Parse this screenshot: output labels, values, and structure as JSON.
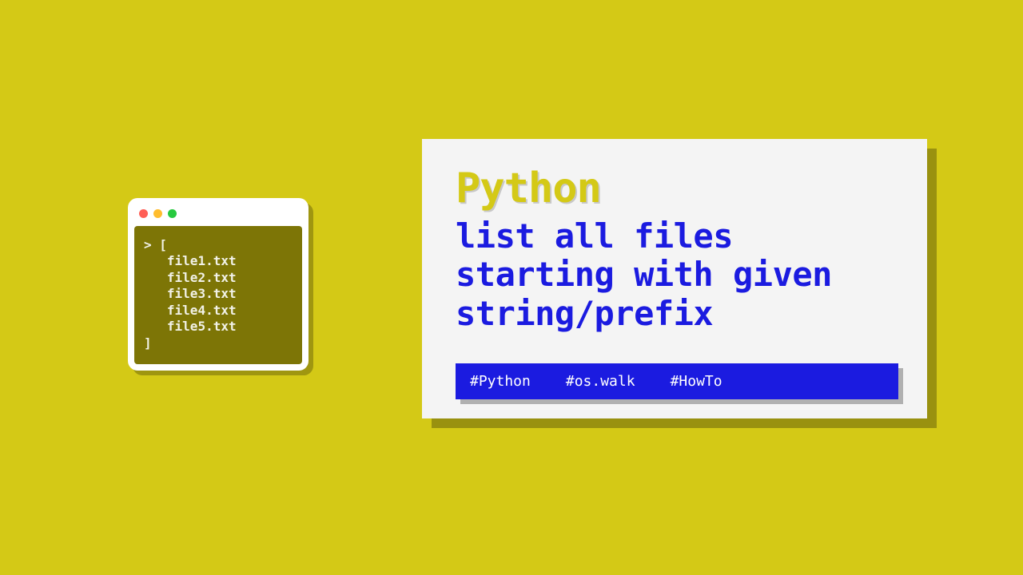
{
  "terminal": {
    "prompt": "> [",
    "files": [
      "file1.txt",
      "file2.txt",
      "file3.txt",
      "file4.txt",
      "file5.txt"
    ],
    "close": "]"
  },
  "card": {
    "title": "Python",
    "subtitle": "list all files starting with given string/prefix",
    "tags": [
      "#Python",
      "#os.walk",
      "#HowTo"
    ]
  }
}
